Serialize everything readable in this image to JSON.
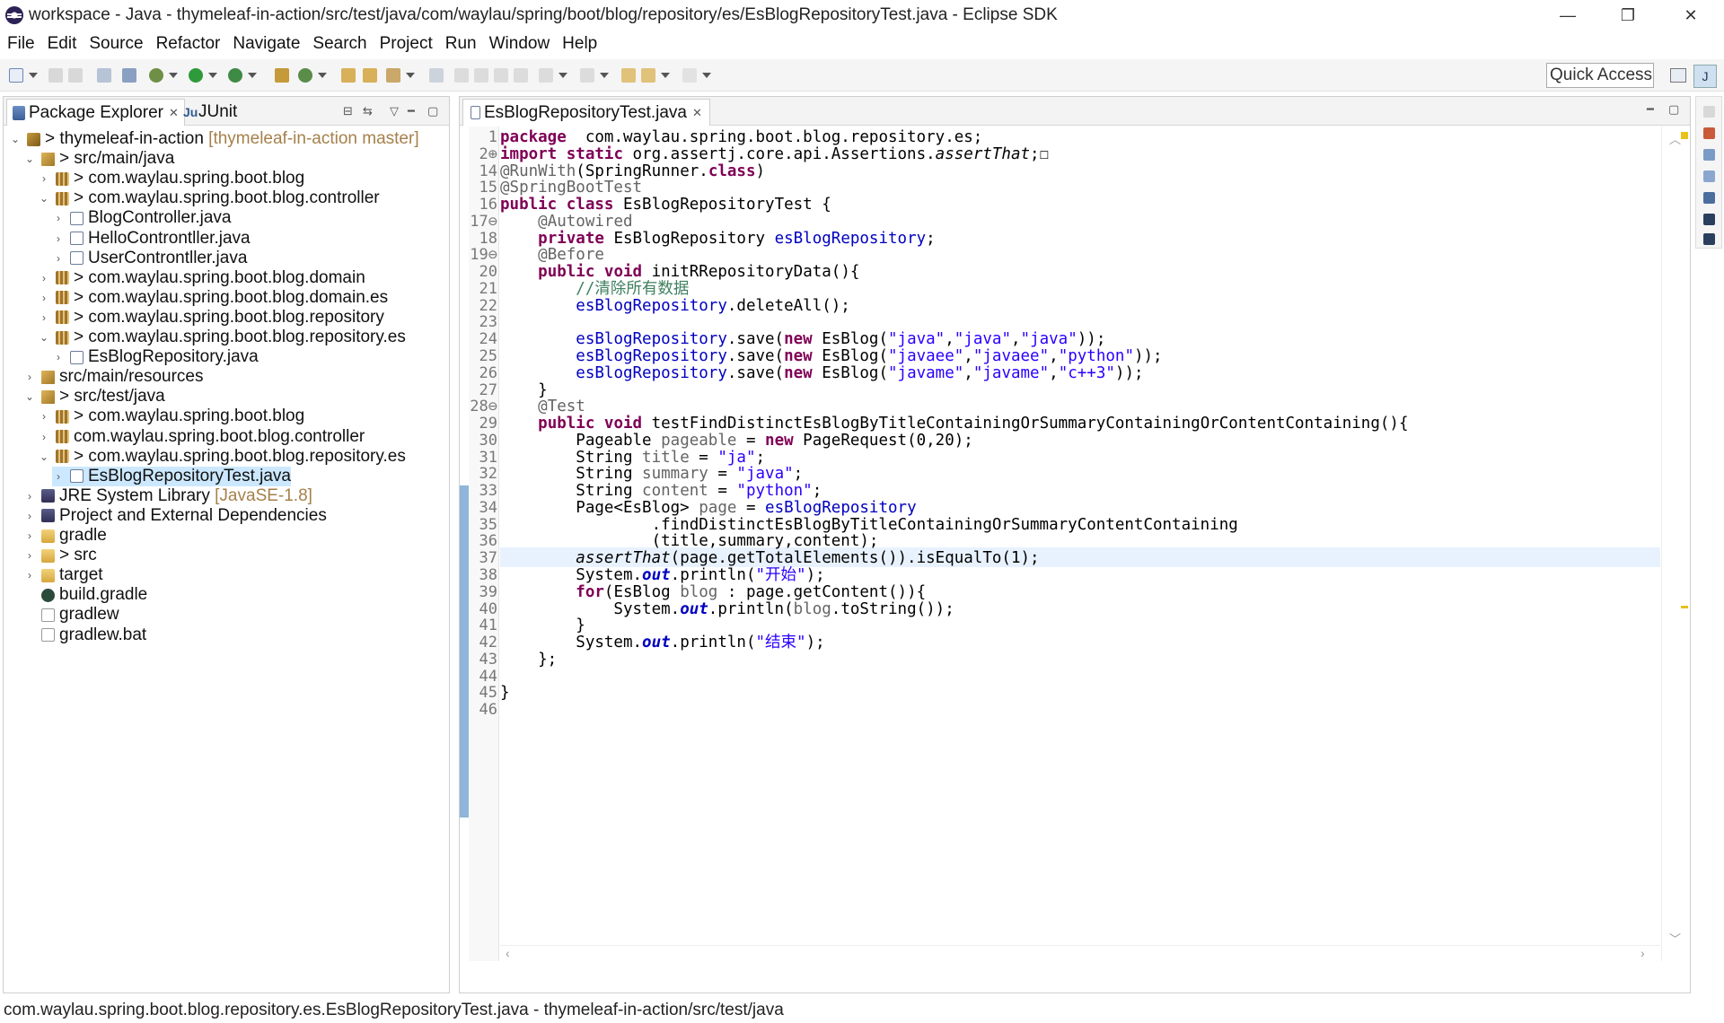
{
  "window": {
    "title": "workspace - Java - thymeleaf-in-action/src/test/java/com/waylau/spring/boot/blog/repository/es/EsBlogRepositoryTest.java - Eclipse SDK",
    "min": "—",
    "max": "❐",
    "close": "✕"
  },
  "menu": [
    "File",
    "Edit",
    "Source",
    "Refactor",
    "Navigate",
    "Search",
    "Project",
    "Run",
    "Window",
    "Help"
  ],
  "toolbar": {
    "quick_access": "Quick Access"
  },
  "explorer": {
    "tab_package_explorer": "Package Explorer",
    "tab_junit": "JUnit",
    "tree": [
      {
        "indent": 0,
        "twisty": "⌄",
        "icon": "project",
        "prefix": "> ",
        "label": "thymeleaf-in-action",
        "decor": " [thymeleaf-in-action master]"
      },
      {
        "indent": 1,
        "twisty": "⌄",
        "icon": "srcfolder",
        "prefix": "> ",
        "label": "src/main/java",
        "decor": ""
      },
      {
        "indent": 2,
        "twisty": "›",
        "icon": "package",
        "prefix": "> ",
        "label": "com.waylau.spring.boot.blog",
        "decor": ""
      },
      {
        "indent": 2,
        "twisty": "⌄",
        "icon": "package",
        "prefix": "> ",
        "label": "com.waylau.spring.boot.blog.controller",
        "decor": ""
      },
      {
        "indent": 3,
        "twisty": "›",
        "icon": "java",
        "prefix": "",
        "label": "BlogController.java",
        "decor": ""
      },
      {
        "indent": 3,
        "twisty": "›",
        "icon": "java",
        "prefix": "",
        "label": "HelloControntller.java",
        "decor": ""
      },
      {
        "indent": 3,
        "twisty": "›",
        "icon": "java",
        "prefix": "",
        "label": "UserControntller.java",
        "decor": ""
      },
      {
        "indent": 2,
        "twisty": "›",
        "icon": "package",
        "prefix": "> ",
        "label": "com.waylau.spring.boot.blog.domain",
        "decor": ""
      },
      {
        "indent": 2,
        "twisty": "›",
        "icon": "package",
        "prefix": "> ",
        "label": "com.waylau.spring.boot.blog.domain.es",
        "decor": ""
      },
      {
        "indent": 2,
        "twisty": "›",
        "icon": "package",
        "prefix": "> ",
        "label": "com.waylau.spring.boot.blog.repository",
        "decor": ""
      },
      {
        "indent": 2,
        "twisty": "⌄",
        "icon": "package",
        "prefix": "> ",
        "label": "com.waylau.spring.boot.blog.repository.es",
        "decor": ""
      },
      {
        "indent": 3,
        "twisty": "›",
        "icon": "java",
        "prefix": "",
        "label": "EsBlogRepository.java",
        "decor": ""
      },
      {
        "indent": 1,
        "twisty": "›",
        "icon": "srcfolder",
        "prefix": "",
        "label": "src/main/resources",
        "decor": ""
      },
      {
        "indent": 1,
        "twisty": "⌄",
        "icon": "srcfolder",
        "prefix": "> ",
        "label": "src/test/java",
        "decor": ""
      },
      {
        "indent": 2,
        "twisty": "›",
        "icon": "package",
        "prefix": "> ",
        "label": "com.waylau.spring.boot.blog",
        "decor": ""
      },
      {
        "indent": 2,
        "twisty": "›",
        "icon": "package",
        "prefix": "",
        "label": "com.waylau.spring.boot.blog.controller",
        "decor": ""
      },
      {
        "indent": 2,
        "twisty": "⌄",
        "icon": "package",
        "prefix": "> ",
        "label": "com.waylau.spring.boot.blog.repository.es",
        "decor": ""
      },
      {
        "indent": 3,
        "twisty": "›",
        "icon": "java",
        "prefix": "",
        "label": "EsBlogRepositoryTest.java",
        "decor": "",
        "selected": true
      },
      {
        "indent": 1,
        "twisty": "›",
        "icon": "library",
        "prefix": "",
        "label": "JRE System Library",
        "decor": " [JavaSE-1.8]"
      },
      {
        "indent": 1,
        "twisty": "›",
        "icon": "library",
        "prefix": "",
        "label": "Project and External Dependencies",
        "decor": ""
      },
      {
        "indent": 1,
        "twisty": "›",
        "icon": "folder",
        "prefix": "",
        "label": "gradle",
        "decor": ""
      },
      {
        "indent": 1,
        "twisty": "›",
        "icon": "folder",
        "prefix": "> ",
        "label": "src",
        "decor": ""
      },
      {
        "indent": 1,
        "twisty": "›",
        "icon": "folder",
        "prefix": "",
        "label": "target",
        "decor": ""
      },
      {
        "indent": 1,
        "twisty": "",
        "icon": "gradle",
        "prefix": "",
        "label": "build.gradle",
        "decor": ""
      },
      {
        "indent": 1,
        "twisty": "",
        "icon": "file",
        "prefix": "",
        "label": "gradlew",
        "decor": ""
      },
      {
        "indent": 1,
        "twisty": "",
        "icon": "file",
        "prefix": "",
        "label": "gradlew.bat",
        "decor": ""
      }
    ]
  },
  "editor": {
    "tab_label": "EsBlogRepositoryTest.java",
    "line_numbers": [
      "1",
      "2⊕",
      "14",
      "15",
      "16",
      "17⊖",
      "18",
      "19⊖",
      "20",
      "21",
      "22",
      "23",
      "24",
      "25",
      "26",
      "27",
      "28⊖",
      "29",
      "30",
      "31",
      "32",
      "33",
      "34",
      "35",
      "36",
      "37",
      "38",
      "39",
      "40",
      "41",
      "42",
      "43",
      "44",
      "45",
      "46"
    ],
    "code": [
      [
        [
          "kw",
          "package"
        ],
        [
          "",
          "  com.waylau.spring.boot.blog.repository.es;"
        ]
      ],
      [
        [
          "kw",
          "import"
        ],
        [
          "",
          " "
        ],
        [
          "kw",
          "static"
        ],
        [
          "",
          " org.assertj.core.api.Assertions."
        ],
        [
          "smeth",
          "assertThat"
        ],
        [
          "",
          ";☐"
        ]
      ],
      [
        [
          "ann",
          "@RunWith"
        ],
        [
          "",
          "(SpringRunner."
        ],
        [
          "kw",
          "class"
        ],
        [
          "",
          ")"
        ]
      ],
      [
        [
          "ann",
          "@SpringBootTest"
        ]
      ],
      [
        [
          "kw",
          "public"
        ],
        [
          "",
          " "
        ],
        [
          "kw",
          "class"
        ],
        [
          "",
          " EsBlogRepositoryTest {"
        ]
      ],
      [
        [
          "",
          "    "
        ],
        [
          "ann",
          "@Autowired"
        ]
      ],
      [
        [
          "",
          "    "
        ],
        [
          "kw",
          "private"
        ],
        [
          "",
          " EsBlogRepository "
        ],
        [
          "fld",
          "esBlogRepository"
        ],
        [
          "",
          ";"
        ]
      ],
      [
        [
          "",
          "    "
        ],
        [
          "ann",
          "@Before"
        ]
      ],
      [
        [
          "",
          "    "
        ],
        [
          "kw",
          "public"
        ],
        [
          "",
          " "
        ],
        [
          "kw",
          "void"
        ],
        [
          "",
          " initRRepositoryData(){"
        ]
      ],
      [
        [
          "",
          "        "
        ],
        [
          "cmt",
          "//清除所有数据"
        ]
      ],
      [
        [
          "",
          "        "
        ],
        [
          "fld",
          "esBlogRepository"
        ],
        [
          "",
          ".deleteAll();"
        ]
      ],
      [
        [
          "",
          ""
        ]
      ],
      [
        [
          "",
          "        "
        ],
        [
          "fld",
          "esBlogRepository"
        ],
        [
          "",
          ".save("
        ],
        [
          "kw",
          "new"
        ],
        [
          "",
          " EsBlog("
        ],
        [
          "str",
          "\"java\""
        ],
        [
          "",
          ","
        ],
        [
          "str",
          "\"java\""
        ],
        [
          "",
          ","
        ],
        [
          "str",
          "\"java\""
        ],
        [
          "",
          "));"
        ]
      ],
      [
        [
          "",
          "        "
        ],
        [
          "fld",
          "esBlogRepository"
        ],
        [
          "",
          ".save("
        ],
        [
          "kw",
          "new"
        ],
        [
          "",
          " EsBlog("
        ],
        [
          "str",
          "\"javaee\""
        ],
        [
          "",
          ","
        ],
        [
          "str",
          "\"javaee\""
        ],
        [
          "",
          ","
        ],
        [
          "str",
          "\"python\""
        ],
        [
          "",
          "));"
        ]
      ],
      [
        [
          "",
          "        "
        ],
        [
          "fld",
          "esBlogRepository"
        ],
        [
          "",
          ".save("
        ],
        [
          "kw",
          "new"
        ],
        [
          "",
          " EsBlog("
        ],
        [
          "str",
          "\"javame\""
        ],
        [
          "",
          ","
        ],
        [
          "str",
          "\"javame\""
        ],
        [
          "",
          ","
        ],
        [
          "str",
          "\"c++3\""
        ],
        [
          "",
          "));"
        ]
      ],
      [
        [
          "",
          "    }"
        ]
      ],
      [
        [
          "",
          "    "
        ],
        [
          "ann",
          "@Test"
        ]
      ],
      [
        [
          "",
          "    "
        ],
        [
          "kw",
          "public"
        ],
        [
          "",
          " "
        ],
        [
          "kw",
          "void"
        ],
        [
          "",
          " testFindDistinctEsBlogByTitleContainingOrSummaryContainingOrContentContaining(){"
        ]
      ],
      [
        [
          "",
          "        Pageable "
        ],
        [
          "ann",
          "pageable"
        ],
        [
          "",
          " = "
        ],
        [
          "kw",
          "new"
        ],
        [
          "",
          " PageRequest(0,20);"
        ]
      ],
      [
        [
          "",
          "        String "
        ],
        [
          "ann",
          "title"
        ],
        [
          "",
          " = "
        ],
        [
          "str",
          "\"ja\""
        ],
        [
          "",
          ";"
        ]
      ],
      [
        [
          "",
          "        String "
        ],
        [
          "ann",
          "summary"
        ],
        [
          "",
          " = "
        ],
        [
          "str",
          "\"java\""
        ],
        [
          "",
          ";"
        ]
      ],
      [
        [
          "",
          "        String "
        ],
        [
          "ann",
          "content"
        ],
        [
          "",
          " = "
        ],
        [
          "str",
          "\"python\""
        ],
        [
          "",
          ";"
        ]
      ],
      [
        [
          "",
          "        Page<EsBlog> "
        ],
        [
          "ann",
          "page"
        ],
        [
          "",
          " = "
        ],
        [
          "fld",
          "esBlogRepository"
        ]
      ],
      [
        [
          "",
          "                .findDistinctEsBlogByTitleContainingOrSummaryContentContaining"
        ]
      ],
      [
        [
          "",
          "                (title,summary,content);"
        ]
      ],
      [
        [
          "",
          "        "
        ],
        [
          "smeth",
          "assertThat"
        ],
        [
          "",
          "(page.getTotalElements()).isEqualTo(1);"
        ]
      ],
      [
        [
          "",
          "        System."
        ],
        [
          "sfld",
          "out"
        ],
        [
          "",
          ".println("
        ],
        [
          "str",
          "\"开始\""
        ],
        [
          "",
          ");"
        ]
      ],
      [
        [
          "",
          "        "
        ],
        [
          "kw",
          "for"
        ],
        [
          "",
          "(EsBlog "
        ],
        [
          "ann",
          "blog"
        ],
        [
          "",
          " : page.getContent()){"
        ]
      ],
      [
        [
          "",
          "            System."
        ],
        [
          "sfld",
          "out"
        ],
        [
          "",
          ".println("
        ],
        [
          "ann",
          "blog"
        ],
        [
          "",
          ".toString());"
        ]
      ],
      [
        [
          "",
          "        }"
        ]
      ],
      [
        [
          "",
          "        System."
        ],
        [
          "sfld",
          "out"
        ],
        [
          "",
          ".println("
        ],
        [
          "str",
          "\"结束\""
        ],
        [
          "",
          ");"
        ]
      ],
      [
        [
          "",
          "    };"
        ]
      ],
      [
        [
          "",
          ""
        ]
      ],
      [
        [
          "",
          "}"
        ]
      ],
      [
        [
          "",
          ""
        ]
      ]
    ]
  },
  "status": {
    "text": "com.waylau.spring.boot.blog.repository.es.EsBlogRepositoryTest.java - thymeleaf-in-action/src/test/java"
  }
}
